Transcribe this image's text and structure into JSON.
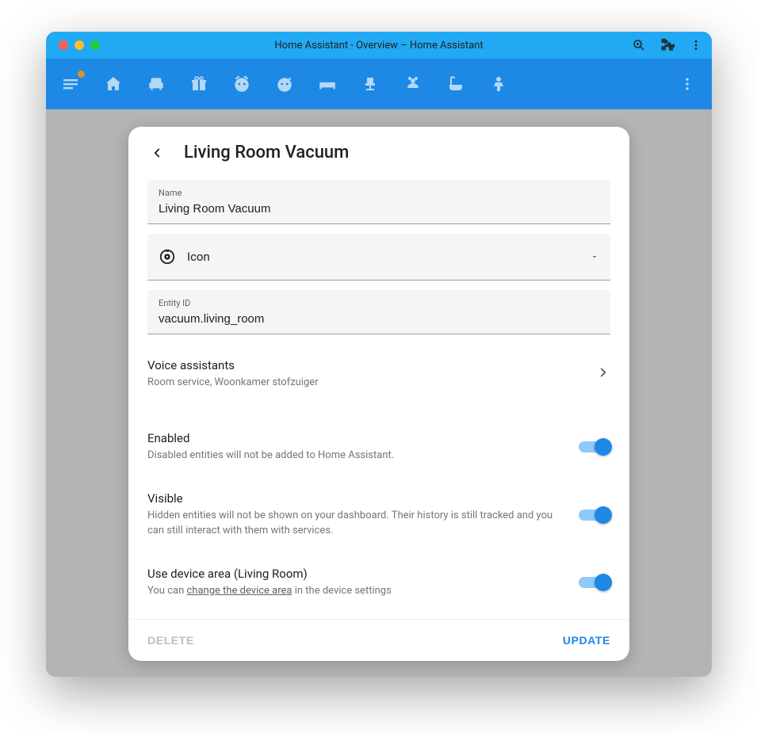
{
  "window": {
    "title": "Home Assistant - Overview – Home Assistant"
  },
  "dialog": {
    "title": "Living Room Vacuum",
    "fields": {
      "name_label": "Name",
      "name_value": "Living Room Vacuum",
      "icon_label": "Icon",
      "entity_id_label": "Entity ID",
      "entity_id_value": "vacuum.living_room"
    },
    "voice": {
      "title": "Voice assistants",
      "subtitle": "Room service, Woonkamer stofzuiger"
    },
    "enabled": {
      "title": "Enabled",
      "subtitle": "Disabled entities will not be added to Home Assistant.",
      "value": true
    },
    "visible": {
      "title": "Visible",
      "subtitle": "Hidden entities will not be shown on your dashboard. Their history is still tracked and you can still interact with them with services.",
      "value": true
    },
    "device_area": {
      "title": "Use device area (Living Room)",
      "subtitle_pre": "You can ",
      "subtitle_link": "change the device area",
      "subtitle_post": " in the device settings",
      "value": true
    },
    "footer": {
      "delete": "Delete",
      "update": "Update"
    }
  }
}
